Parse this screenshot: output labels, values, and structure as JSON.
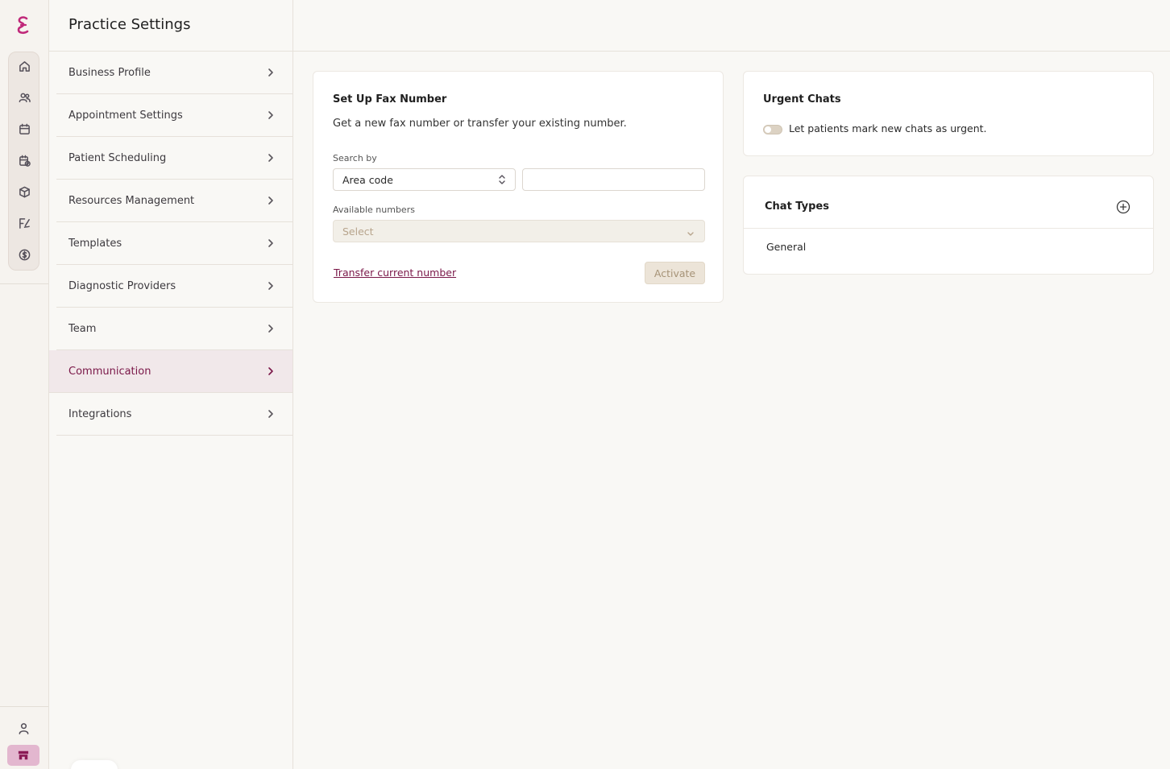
{
  "settings": {
    "title": "Practice Settings",
    "nav": [
      {
        "label": "Business Profile"
      },
      {
        "label": "Appointment Settings"
      },
      {
        "label": "Patient Scheduling"
      },
      {
        "label": "Resources Management"
      },
      {
        "label": "Templates"
      },
      {
        "label": "Diagnostic Providers"
      },
      {
        "label": "Team"
      },
      {
        "label": "Communication",
        "active": true
      },
      {
        "label": "Integrations"
      }
    ]
  },
  "fax": {
    "title": "Set Up Fax Number",
    "subtitle": "Get a new fax number or transfer your existing number.",
    "search_by_label": "Search by",
    "search_by_value": "Area code",
    "search_value": "",
    "available_label": "Available numbers",
    "available_placeholder": "Select",
    "transfer_link": "Transfer current number",
    "activate_button": "Activate"
  },
  "urgent": {
    "title": "Urgent Chats",
    "toggle_label": "Let patients mark new chats as urgent.",
    "toggle_on": false
  },
  "chat_types": {
    "title": "Chat Types",
    "items": [
      "General"
    ]
  },
  "colors": {
    "accent": "#7a1748",
    "active_nav_bg": "#f1e8ea",
    "rail_practice_bg": "#e3b7cf"
  },
  "icons": {
    "rail": [
      "home-icon",
      "users-icon",
      "calendar-icon",
      "calendar-check-icon",
      "box-icon",
      "signature-icon",
      "dollar-icon"
    ],
    "rail_bottom": [
      "user-icon",
      "store-icon"
    ]
  }
}
